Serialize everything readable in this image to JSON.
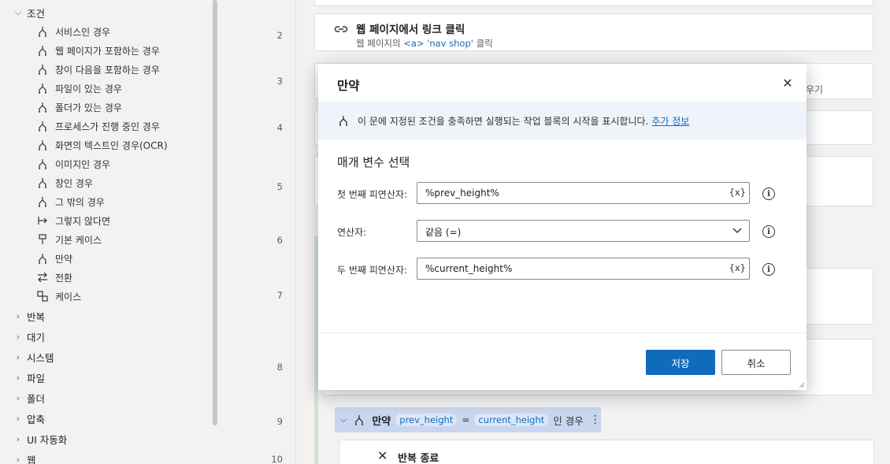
{
  "sidebar": {
    "condition_group": "조건",
    "condition_items": [
      {
        "label": "서비스인 경우",
        "icon": "branch-icon"
      },
      {
        "label": "웹 페이지가 포함하는 경우",
        "icon": "branch-icon"
      },
      {
        "label": "창이 다음을 포함하는 경우",
        "icon": "branch-icon"
      },
      {
        "label": "파일이 있는 경우",
        "icon": "branch-icon"
      },
      {
        "label": "폴더가 있는 경우",
        "icon": "branch-icon"
      },
      {
        "label": "프로세스가 진행 중인 경우",
        "icon": "branch-icon"
      },
      {
        "label": "화면의 텍스트인 경우(OCR)",
        "icon": "branch-icon"
      },
      {
        "label": "이미지인 경우",
        "icon": "branch-icon"
      },
      {
        "label": "창인 경우",
        "icon": "branch-icon"
      },
      {
        "label": "그 밖의 경우",
        "icon": "branch-icon"
      },
      {
        "label": "그렇지 않다면",
        "icon": "else-arrow-icon"
      },
      {
        "label": "기본 케이스",
        "icon": "default-case-icon"
      },
      {
        "label": "만약",
        "icon": "branch-icon"
      },
      {
        "label": "전환",
        "icon": "switch-arrows-icon"
      },
      {
        "label": "케이스",
        "icon": "case-icon"
      }
    ],
    "groups": [
      "반복",
      "대기",
      "시스템",
      "파일",
      "폴더",
      "압축",
      "UI 자동화",
      "웹"
    ]
  },
  "flow": {
    "line_numbers": [
      "2",
      "3",
      "4",
      "5",
      "6",
      "7",
      "8",
      "9",
      "10"
    ],
    "step2": {
      "title": "웹 페이지에서 링크 클릭",
      "subtitle_pre": "웹 페이지의",
      "subtitle_tag": "<a> 'nav shop'",
      "subtitle_post": "클릭"
    },
    "partial_text_step3": "우기",
    "if_block": {
      "title": "만약",
      "left_operand": "prev_height",
      "operator": "=",
      "right_operand": "current_height",
      "suffix": "인 경우"
    },
    "end_loop": "반복 종료"
  },
  "dialog": {
    "title": "만약",
    "info_text": "이 문에 지정된 조건을 충족하면 실행되는 작업 블록의 시작을 표시합니다.",
    "info_link": "추가 정보",
    "section_title": "매개 변수 선택",
    "first_operand_label": "첫 번째 피연산자:",
    "first_operand_value": "%prev_height%",
    "operator_label": "연산자:",
    "operator_value": "같음 (=)",
    "second_operand_label": "두 번째 피연산자:",
    "second_operand_value": "%current_height%",
    "var_token": "{x}",
    "save_label": "저장",
    "cancel_label": "취소",
    "accent_color": "#0f6cbd"
  }
}
